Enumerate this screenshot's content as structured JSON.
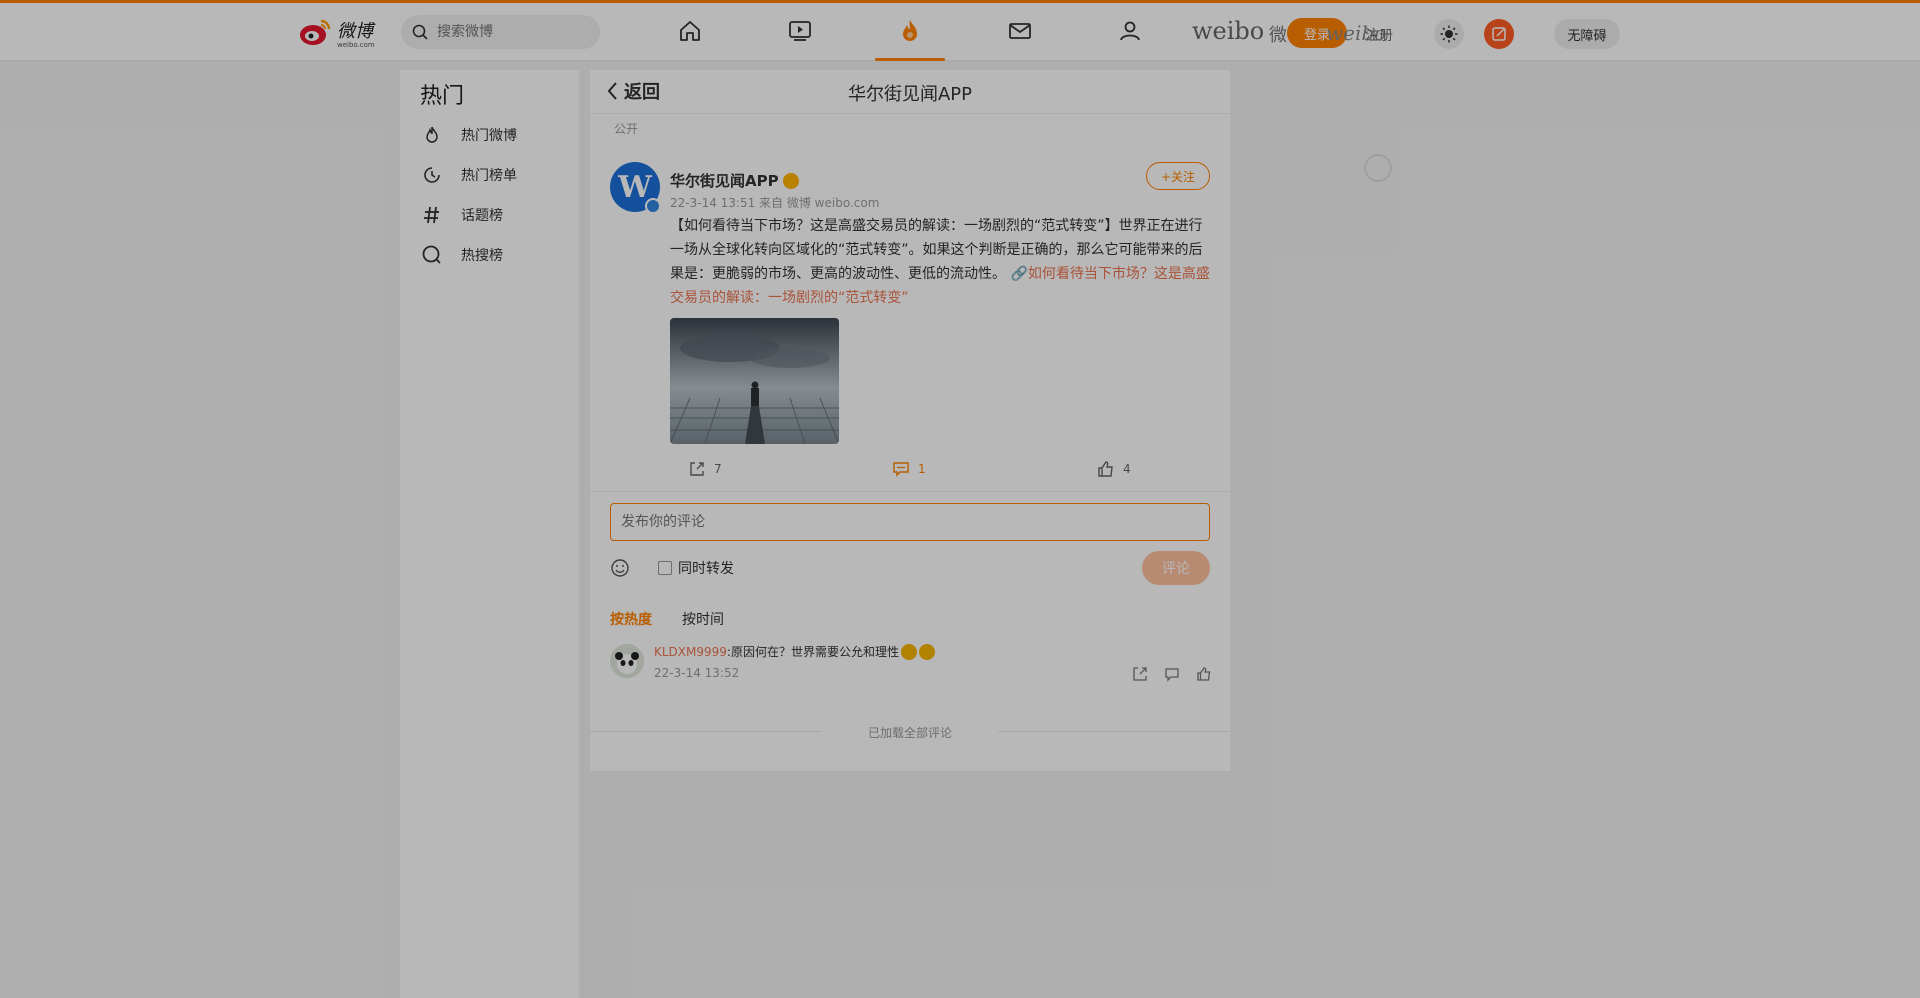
{
  "header": {
    "search_placeholder": "搜索微博",
    "brand_word": "weibo",
    "brand_cn": "微博",
    "login_label": "登录",
    "watermark": "weibo",
    "register_label": "注册",
    "accessibility_label": "无障碍",
    "accent": "#ff8200"
  },
  "sidebar": {
    "title": "热门",
    "items": [
      {
        "label": "热门微博",
        "icon": "flame-icon"
      },
      {
        "label": "热门榜单",
        "icon": "clock-icon"
      },
      {
        "label": "话题榜",
        "icon": "hashtag-icon"
      },
      {
        "label": "热搜榜",
        "icon": "search-ring-icon"
      }
    ]
  },
  "main": {
    "back_label": "返回",
    "page_title": "华尔街见闻APP",
    "visibility": "公开",
    "post": {
      "author": "华尔街见闻APP",
      "meta": "22-3-14 13:51  来自 微博 weibo.com",
      "follow_label": "+关注",
      "text": "【如何看待当下市场？这是高盛交易员的解读：一场剧烈的“范式转变”】世界正在进行一场从全球化转向区域化的“范式转变”。如果这个判断是正确的，那么它可能带来的后果是：更脆弱的市场、更高的波动性、更低的流动性。",
      "link_text": "如何看待当下市场？这是高盛交易员的解读：一场剧烈的“范式转变”",
      "reposts": "7",
      "comments": "1",
      "likes": "4"
    },
    "composer": {
      "placeholder": "发布你的评论",
      "repost_label": "同时转发",
      "submit_label": "评论"
    },
    "sort": {
      "hot": "按热度",
      "time": "按时间"
    },
    "comments": [
      {
        "user": "KLDXM9999",
        "text": ":原因何在？世界需要公允和理性",
        "time": "22-3-14 13:52"
      }
    ],
    "end_text": "已加载全部评论"
  }
}
